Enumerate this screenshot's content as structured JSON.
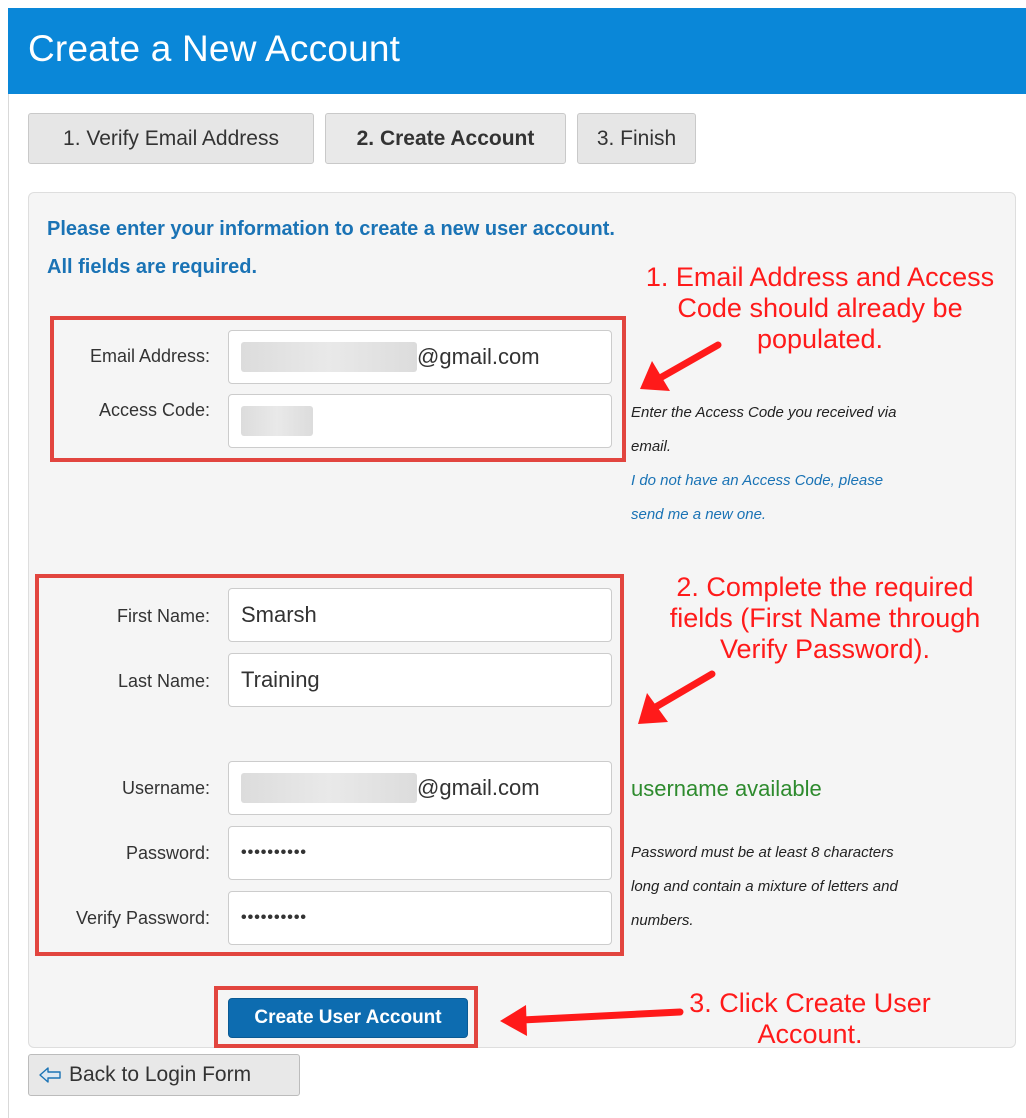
{
  "header": {
    "title": "Create a New Account"
  },
  "steps": [
    {
      "label": "1. Verify Email Address"
    },
    {
      "label": "2. Create Account"
    },
    {
      "label": "3. Finish"
    }
  ],
  "intro": {
    "line1": "Please enter your information to create a new user account.",
    "line2": "All fields are required."
  },
  "form": {
    "email": {
      "label": "Email Address:",
      "suffix": "@gmail.com"
    },
    "access_code": {
      "label": "Access Code:"
    },
    "first_name": {
      "label": "First Name:",
      "value": "Smarsh"
    },
    "last_name": {
      "label": "Last Name:",
      "value": "Training"
    },
    "username": {
      "label": "Username:",
      "suffix": "@gmail.com",
      "status": "username available"
    },
    "password": {
      "label": "Password:",
      "value": "••••••••••"
    },
    "verify_password": {
      "label": "Verify Password:",
      "value": "••••••••••"
    }
  },
  "hints": {
    "access_line1": "Enter the Access Code you received via",
    "access_line2": "email.",
    "link_line1": "I do not have an Access Code, please",
    "link_line2": "send me a new one.",
    "password_line1": "Password must be at least 8 characters",
    "password_line2": "long and contain a mixture of letters and",
    "password_line3": "numbers."
  },
  "annotations": {
    "note1_line1": "1. Email Address and Access",
    "note1_line2": "Code should already be",
    "note1_line3": "populated.",
    "note2_line1": "2. Complete the required",
    "note2_line2": "fields (First Name through",
    "note2_line3": "Verify Password).",
    "note3_line1": "3. Click Create User",
    "note3_line2": "Account."
  },
  "buttons": {
    "create": "Create User Account",
    "back": "Back to Login Form"
  },
  "colors": {
    "header_bg": "#0a87d8",
    "primary_btn": "#0d6cb0",
    "annotation_red": "#ff1a1a",
    "success_green": "#2e8b2e",
    "link_blue": "#1a73b5"
  },
  "icons": {
    "back": "arrow-left-icon",
    "annotation_arrow": "red-arrow-icon"
  }
}
